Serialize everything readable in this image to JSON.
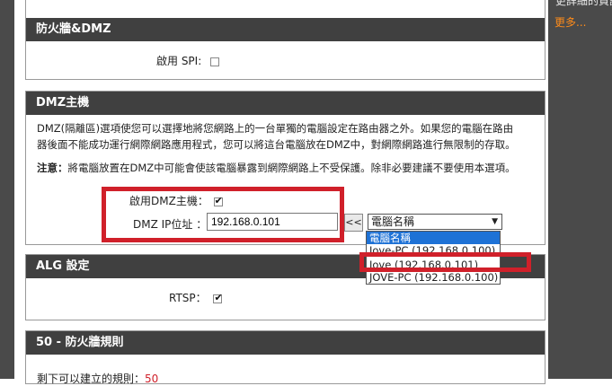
{
  "top_cut_text": "更詳細的資訊",
  "sidebar": {
    "more_label": "更多..."
  },
  "firewall": {
    "title": "防火牆&DMZ",
    "spi_label": "啟用 SPI:",
    "spi_checked": false
  },
  "dmz": {
    "title": "DMZ主機",
    "desc_line1": "DMZ(隔離區)選項使您可以選擇地將您網路上的一台單獨的電腦設定在路由器之外。如果您的電腦在路由",
    "desc_line2": "器後面不能成功運行網際網路應用程式，您可以將這台電腦放在DMZ中，對網際網路進行無限制的存取。",
    "note_label": "注意：",
    "note_text": "將電腦放置在DMZ中可能會使該電腦暴露到網際網路上不受保護。除非必要建議不要使用本選項。",
    "enable_label": "啟用DMZ主機：",
    "enable_checked": true,
    "ip_label": "DMZ IP位址 ：",
    "ip_value": "192.168.0.101",
    "copy_button": "<<",
    "select_value": "電腦名稱",
    "options": [
      "電腦名稱",
      "Jove-PC (192.168.0.100)",
      "Jove (192.168.0.101)",
      "JOVE-PC (192.168.0.100)"
    ]
  },
  "alg": {
    "title": "ALG 設定",
    "rtsp_label": "RTSP：",
    "rtsp_checked": true
  },
  "rules": {
    "title": "50 - 防火牆規則",
    "remaining_label": "剩下可以建立的規則：",
    "remaining_value": "50"
  },
  "colors": {
    "header_bg": "#404040",
    "accent_orange": "#ff8c1a",
    "highlight_red": "#d0202a",
    "selection_blue": "#1e72d6"
  }
}
